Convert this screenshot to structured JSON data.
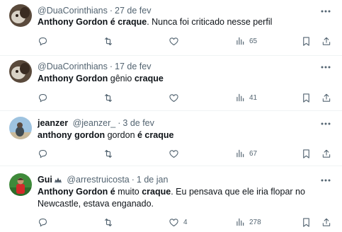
{
  "tweets": [
    {
      "display_name": "",
      "handle": "@DuaCorinthians",
      "sep": "·",
      "date": "27 de fev",
      "text_bold_1": "Anthony Gordon",
      "text_mid_1": " ",
      "text_bold_2": "é craque",
      "text_rest": ". Nunca foi criticado nesse perfil",
      "views": "65",
      "likes": ""
    },
    {
      "display_name": "",
      "handle": "@DuaCorinthians",
      "sep": "·",
      "date": "17 de fev",
      "text_bold_1": "Anthony Gordon",
      "text_mid_1": " gênio ",
      "text_bold_2": "craque",
      "text_rest": "",
      "views": "41",
      "likes": ""
    },
    {
      "display_name": "jeanzer",
      "handle": "@jeanzer_",
      "sep": "·",
      "date": "3 de fev",
      "text_bold_1": "anthony gordon",
      "text_mid_1": " gordon ",
      "text_bold_2": "é craque",
      "text_rest": "",
      "views": "67",
      "likes": ""
    },
    {
      "display_name": "Gui",
      "handle": "@arrestruicosta",
      "sep": "·",
      "date": "1 de jan",
      "text_bold_1": "Anthony Gordon é",
      "text_mid_1": " muito ",
      "text_bold_2": "craque",
      "text_rest": ". Eu pensava que ele iria flopar no Newcastle, estava enganado.",
      "views": "278",
      "likes": "4"
    }
  ],
  "icons": {
    "reply": "reply-icon",
    "retweet": "retweet-icon",
    "like": "heart-icon",
    "views": "views-chart-icon",
    "bookmark": "bookmark-icon",
    "share": "share-icon",
    "more": "more-dots-icon"
  },
  "colors": {
    "text": "#0f1419",
    "secondary": "#536471",
    "divider": "#eff3f4"
  }
}
